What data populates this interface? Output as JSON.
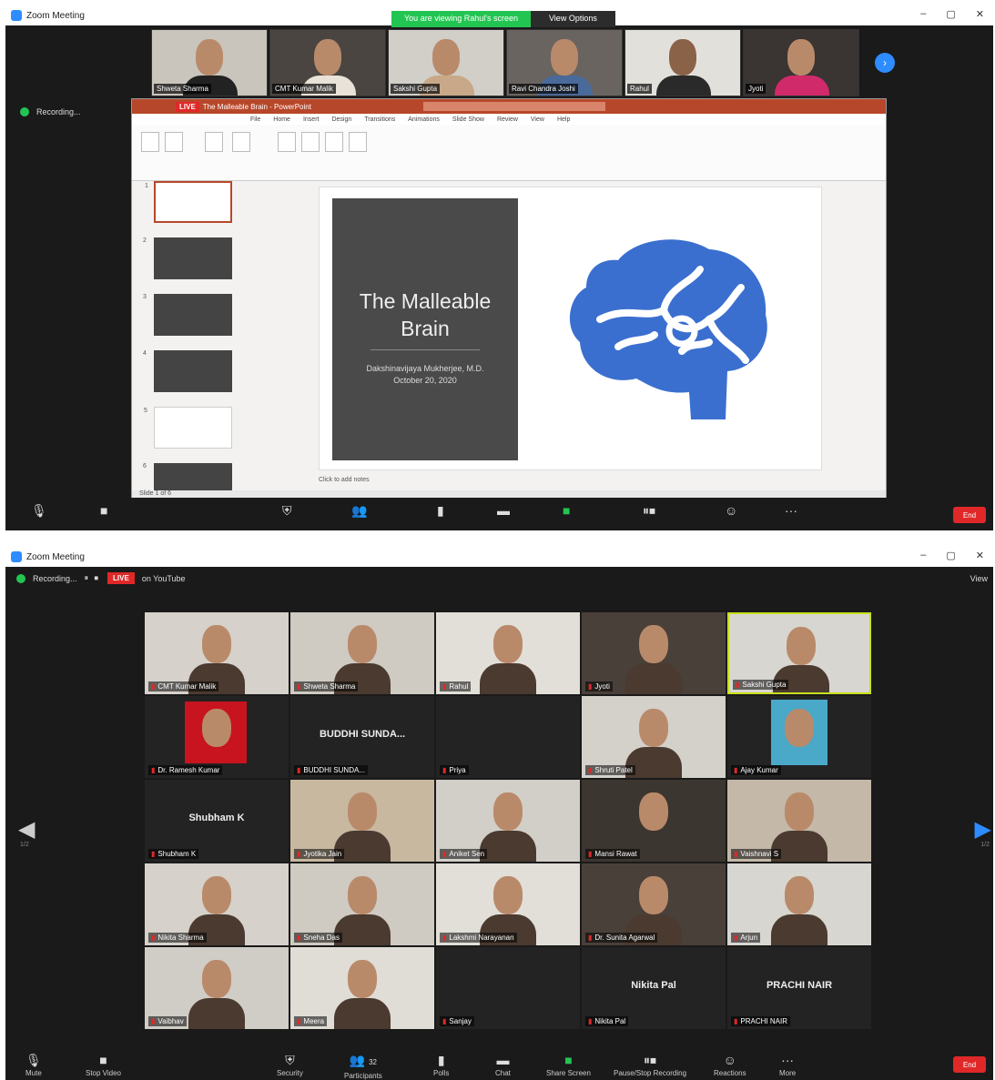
{
  "window_top": {
    "title": "Zoom Meeting",
    "share_banner": {
      "status": "You are viewing Rahul's screen",
      "view_options": "View Options"
    },
    "recording": {
      "label": "Recording..."
    },
    "thumbnails": [
      {
        "name": "Shweta Sharma"
      },
      {
        "name": "CMT Kumar Malik"
      },
      {
        "name": "Sakshi Gupta"
      },
      {
        "name": "Ravi Chandra Joshi"
      },
      {
        "name": "Rahul"
      },
      {
        "name": "Jyoti"
      }
    ],
    "powerpoint": {
      "title": "The Malleable Brain - PowerPoint",
      "live": "LIVE",
      "tabs": [
        "File",
        "Home",
        "Insert",
        "Design",
        "Transitions",
        "Animations",
        "Slide Show",
        "Review",
        "View",
        "Help"
      ],
      "slide": {
        "title": "The Malleable Brain",
        "subtitle_line1": "Dakshinavijaya Mukherjee, M.D.",
        "subtitle_line2": "October 20, 2020"
      },
      "notes": "Click to add notes",
      "status": "Slide 1 of 6"
    }
  },
  "window_bottom": {
    "title": "Zoom Meeting",
    "recording": "Recording...",
    "live": "LIVE",
    "live_on": "on YouTube",
    "view": "View",
    "participants": [
      {
        "name": "CMT Kumar Malik",
        "kind": "video"
      },
      {
        "name": "Shweta Sharma",
        "kind": "video"
      },
      {
        "name": "Rahul",
        "kind": "video"
      },
      {
        "name": "Jyoti",
        "kind": "video"
      },
      {
        "name": "Sakshi Gupta",
        "kind": "video",
        "active": true
      },
      {
        "name": "Dr. Ramesh Kumar",
        "kind": "photo-red"
      },
      {
        "name": "BUDDHI SUNDA...",
        "kind": "name"
      },
      {
        "name": "Priya",
        "kind": "blank"
      },
      {
        "name": "Shruti Patel",
        "kind": "video"
      },
      {
        "name": "Ajay Kumar",
        "kind": "photo-blue"
      },
      {
        "name": "Shubham K",
        "kind": "name"
      },
      {
        "name": "Jyotika Jain",
        "kind": "video"
      },
      {
        "name": "Aniket Sen",
        "kind": "video"
      },
      {
        "name": "Mansi Rawat",
        "kind": "photo-dark"
      },
      {
        "name": "Vaishnavi S",
        "kind": "video"
      },
      {
        "name": "Nikita Sharma",
        "kind": "video"
      },
      {
        "name": "Sneha Das",
        "kind": "video"
      },
      {
        "name": "Lakshmi Narayanan",
        "kind": "video"
      },
      {
        "name": "Dr. Sunita Agarwal",
        "kind": "video"
      },
      {
        "name": "Arjun",
        "kind": "video"
      },
      {
        "name": "Vaibhav",
        "kind": "video"
      },
      {
        "name": "Meera",
        "kind": "video"
      },
      {
        "name": "Sanjay",
        "kind": "blank"
      },
      {
        "name": "Nikita Pal",
        "kind": "name"
      },
      {
        "name": "PRACHI NAIR",
        "kind": "name"
      }
    ],
    "pager_left": "1/2",
    "pager_right": "1/2"
  },
  "toolbar": {
    "mute": "Mute",
    "stop_video": "Stop Video",
    "security": "Security",
    "participants": "Participants",
    "participants_count": "32",
    "polls": "Polls",
    "chat": "Chat",
    "share_screen": "Share Screen",
    "pause_stop_recording": "Pause/Stop Recording",
    "reactions": "Reactions",
    "more": "More",
    "end": "End"
  }
}
